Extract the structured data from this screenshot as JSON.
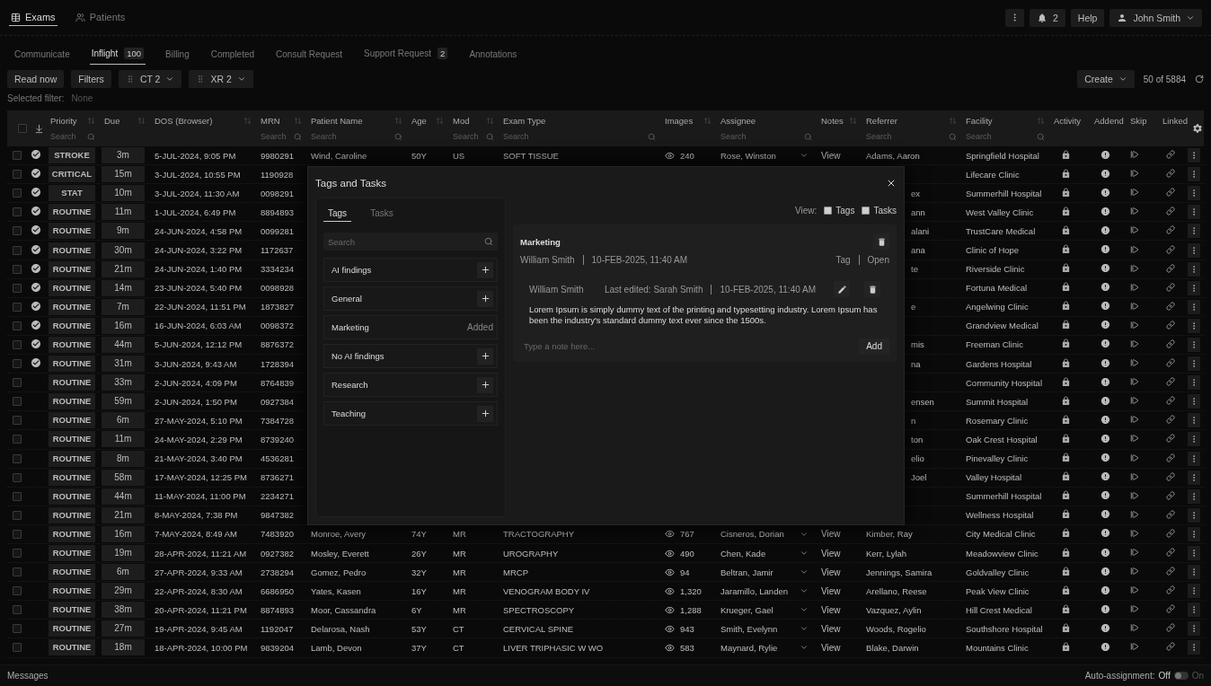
{
  "nav_tabs": [
    {
      "label": "Exams",
      "selected": true,
      "kind": "table"
    },
    {
      "label": "Patients",
      "selected": false,
      "kind": "people"
    }
  ],
  "header_actions": {
    "notifications": "2",
    "help": "Help",
    "user": "John Smith"
  },
  "sub_tabs": [
    {
      "label": "Communicate",
      "selected": false
    },
    {
      "label": "Inflight",
      "count": "100",
      "selected": true
    },
    {
      "label": "Billing",
      "selected": false
    },
    {
      "label": "Completed",
      "selected": false
    },
    {
      "label": "Consult Request",
      "selected": false
    },
    {
      "label": "Support Request",
      "count": "2",
      "selected": false
    },
    {
      "label": "Annotations",
      "selected": false
    }
  ],
  "toolbar": {
    "buttons": [
      "Read now",
      "Filters"
    ],
    "chips": [
      {
        "label": "CT",
        "count": "2"
      },
      {
        "label": "XR",
        "count": "2"
      }
    ],
    "create": "Create",
    "count": "50 of 5884"
  },
  "selected_filter": {
    "label": "Selected filter:",
    "value": "None"
  },
  "table": {
    "columns": [
      {
        "kind": "checkbox",
        "checked": false
      },
      {
        "kind": "download"
      },
      {
        "kind": "text",
        "label": "Priority",
        "sortable": true,
        "search": {
          "placeholder": "Search"
        }
      },
      {
        "kind": "text",
        "label": "Due",
        "sortable": true
      },
      {
        "kind": "text",
        "label": "DOS (Browser)",
        "sortable": true
      },
      {
        "kind": "text",
        "label": "MRN",
        "sortable": true,
        "search": {
          "placeholder": "Search"
        }
      },
      {
        "kind": "text",
        "label": "Patient Name",
        "sortable": true,
        "search": {
          "placeholder": "Search"
        }
      },
      {
        "kind": "text",
        "label": "Age",
        "sortable": true
      },
      {
        "kind": "text",
        "label": "Mod",
        "sortable": true,
        "search": {
          "placeholder": "Search"
        }
      },
      {
        "kind": "text",
        "label": "Exam Type",
        "sortable": false,
        "search": {
          "placeholder": "Search"
        }
      },
      {
        "kind": "text",
        "label": "Images",
        "sortable": true
      },
      {
        "kind": "text",
        "label": "Assignee",
        "sortable": false,
        "search": {
          "placeholder": "Search"
        }
      },
      {
        "kind": "text",
        "label": "Notes",
        "sortable": true
      },
      {
        "kind": "text",
        "label": "Referrer",
        "sortable": true,
        "search": {
          "placeholder": "Search"
        }
      },
      {
        "kind": "text",
        "label": "Facility",
        "sortable": true,
        "search": {
          "placeholder": "Search"
        }
      },
      {
        "kind": "text",
        "label": "Activity",
        "sortable": false
      },
      {
        "kind": "text",
        "label": "Addend",
        "sortable": false
      },
      {
        "kind": "text",
        "label": "Skip",
        "sortable": false
      },
      {
        "kind": "text",
        "label": "Linked",
        "sortable": false
      },
      {
        "kind": "settings"
      }
    ],
    "rows": [
      {
        "selected": false,
        "reviewed": true,
        "priority": "STROKE",
        "due": "3m",
        "dos": "5-JUL-2024, 9:05 PM",
        "mrn": "9980291",
        "patient": "Wind, Caroline",
        "age": "50Y",
        "mod": "US",
        "exam": "SOFT TISSUE",
        "images": "240",
        "assignee": "Rose, Winston",
        "notes": "View",
        "referrer": "Adams, Aaron",
        "facility": "Springfield Hospital"
      },
      {
        "selected": false,
        "reviewed": true,
        "priority": "CRITICAL",
        "due": "15m",
        "dos": "3-JUL-2024, 10:55 PM",
        "mrn": "1190928",
        "facility": "Lifecare Clinic"
      },
      {
        "selected": false,
        "reviewed": true,
        "priority": "STAT",
        "due": "10m",
        "dos": "3-JUL-2024, 11:30 AM",
        "mrn": "0098291",
        "referrer_fragment": "ex",
        "facility": "Summerhill Hospital"
      },
      {
        "selected": false,
        "reviewed": true,
        "priority": "ROUTINE",
        "due": "11m",
        "dos": "1-JUL-2024, 6:49 PM",
        "mrn": "8894893",
        "referrer_fragment": "ann",
        "facility": "West Valley Clinic"
      },
      {
        "selected": false,
        "reviewed": true,
        "priority": "ROUTINE",
        "due": "9m",
        "dos": "24-JUN-2024, 4:58 PM",
        "mrn": "0099281",
        "referrer_fragment": "alani",
        "facility": "TrustCare Medical"
      },
      {
        "selected": false,
        "reviewed": true,
        "priority": "ROUTINE",
        "due": "30m",
        "dos": "24-JUN-2024, 3:22 PM",
        "mrn": "1172637",
        "referrer_fragment": "ana",
        "facility": "Clinic of Hope"
      },
      {
        "selected": false,
        "reviewed": true,
        "priority": "ROUTINE",
        "due": "21m",
        "dos": "24-JUN-2024, 1:40 PM",
        "mrn": "3334234",
        "referrer_fragment": "te",
        "facility": "Riverside Clinic"
      },
      {
        "selected": false,
        "reviewed": true,
        "priority": "ROUTINE",
        "due": "14m",
        "dos": "23-JUN-2024, 5:40 PM",
        "mrn": "0098928",
        "facility": "Fortuna Medical"
      },
      {
        "selected": false,
        "reviewed": true,
        "priority": "ROUTINE",
        "due": "7m",
        "dos": "22-JUN-2024, 11:51 PM",
        "mrn": "1873827",
        "referrer_fragment": "e",
        "facility": "Angelwing Clinic"
      },
      {
        "selected": false,
        "reviewed": true,
        "priority": "ROUTINE",
        "due": "16m",
        "dos": "16-JUN-2024, 6:03 AM",
        "mrn": "0098372",
        "facility": "Grandview Medical"
      },
      {
        "selected": false,
        "reviewed": true,
        "priority": "ROUTINE",
        "due": "44m",
        "dos": "5-JUN-2024, 12:12 PM",
        "mrn": "8876372",
        "referrer_fragment": "mis",
        "facility": "Freeman Clinic"
      },
      {
        "selected": false,
        "reviewed": true,
        "priority": "ROUTINE",
        "due": "31m",
        "dos": "3-JUN-2024, 9:43 AM",
        "mrn": "1728394",
        "referrer_fragment": "na",
        "facility": "Gardens Hospital"
      },
      {
        "selected": false,
        "reviewed": false,
        "priority": "ROUTINE",
        "due": "33m",
        "dos": "2-JUN-2024, 4:09 PM",
        "mrn": "8764839",
        "facility": "Community Hospital"
      },
      {
        "selected": false,
        "reviewed": false,
        "priority": "ROUTINE",
        "due": "59m",
        "dos": "2-JUN-2024, 1:50 PM",
        "mrn": "0927384",
        "referrer_fragment": "ensen",
        "facility": "Summit Hospital"
      },
      {
        "selected": false,
        "reviewed": false,
        "priority": "ROUTINE",
        "due": "6m",
        "dos": "27-MAY-2024, 5:10 PM",
        "mrn": "7384728",
        "referrer_fragment": "n",
        "facility": "Rosemary Clinic"
      },
      {
        "selected": false,
        "reviewed": false,
        "priority": "ROUTINE",
        "due": "11m",
        "dos": "24-MAY-2024, 2:29 PM",
        "mrn": "8739240",
        "referrer_fragment": "ton",
        "facility": "Oak Crest Hospital"
      },
      {
        "selected": false,
        "reviewed": false,
        "priority": "ROUTINE",
        "due": "8m",
        "dos": "21-MAY-2024, 3:40 PM",
        "mrn": "4536281",
        "referrer_fragment": "elio",
        "facility": "Pinevalley Clinic"
      },
      {
        "selected": false,
        "reviewed": false,
        "priority": "ROUTINE",
        "due": "58m",
        "dos": "17-MAY-2024, 12:25 PM",
        "mrn": "8736271",
        "referrer_fragment": "Joel",
        "facility": "Valley Hospital"
      },
      {
        "selected": false,
        "reviewed": false,
        "priority": "ROUTINE",
        "due": "44m",
        "dos": "11-MAY-2024, 11:00 PM",
        "mrn": "2234271",
        "facility": "Summerhill Hospital"
      },
      {
        "selected": false,
        "reviewed": false,
        "priority": "ROUTINE",
        "due": "21m",
        "dos": "8-MAY-2024, 7:38 PM",
        "mrn": "9847382",
        "facility": "Wellness Hospital"
      },
      {
        "selected": false,
        "reviewed": false,
        "priority": "ROUTINE",
        "due": "16m",
        "dos": "7-MAY-2024, 8:49 AM",
        "mrn": "7483920",
        "patient": "Monroe, Avery",
        "age": "74Y",
        "mod": "MR",
        "exam": "TRACTOGRAPHY",
        "images": "767",
        "assignee": "Cisneros, Dorian",
        "notes": "View",
        "referrer": "Kimber, Ray",
        "facility": "City Medical Clinic"
      },
      {
        "selected": false,
        "reviewed": false,
        "priority": "ROUTINE",
        "due": "19m",
        "dos": "28-APR-2024, 11:21 AM",
        "mrn": "0927382",
        "patient": "Mosley, Everett",
        "age": "26Y",
        "mod": "MR",
        "exam": "UROGRAPHY",
        "images": "490",
        "assignee": "Chen, Kade",
        "notes": "View",
        "referrer": "Kerr, Lylah",
        "facility": "Meadowview Clinic"
      },
      {
        "selected": false,
        "reviewed": false,
        "priority": "ROUTINE",
        "due": "6m",
        "dos": "27-APR-2024, 9:33 AM",
        "mrn": "2738294",
        "patient": "Gomez, Pedro",
        "age": "32Y",
        "mod": "MR",
        "exam": "MRCP",
        "images": "94",
        "assignee": "Beltran, Jamir",
        "notes": "View",
        "referrer": "Jennings, Samira",
        "facility": "Goldvalley Clinic"
      },
      {
        "selected": false,
        "reviewed": false,
        "priority": "ROUTINE",
        "due": "29m",
        "dos": "22-APR-2024, 8:30 AM",
        "mrn": "6686950",
        "patient": "Yates, Kasen",
        "age": "16Y",
        "mod": "MR",
        "exam": "VENOGRAM BODY IV",
        "images": "1,320",
        "assignee": "Jaramillo, Landen",
        "notes": "View",
        "referrer": "Arellano, Reese",
        "facility": "Peak View Clinic"
      },
      {
        "selected": false,
        "reviewed": false,
        "priority": "ROUTINE",
        "due": "38m",
        "dos": "20-APR-2024, 11:21 PM",
        "mrn": "8874893",
        "patient": "Moor, Cassandra",
        "age": "6Y",
        "mod": "MR",
        "exam": "SPECTROSCOPY",
        "images": "1,288",
        "assignee": "Krueger, Gael",
        "notes": "View",
        "referrer": "Vazquez, Aylin",
        "facility": "Hill Crest Medical"
      },
      {
        "selected": false,
        "reviewed": false,
        "priority": "ROUTINE",
        "due": "27m",
        "dos": "19-APR-2024, 9:45 AM",
        "mrn": "1192047",
        "patient": "Delarosa, Nash",
        "age": "53Y",
        "mod": "CT",
        "exam": "CERVICAL SPINE",
        "images": "943",
        "assignee": "Smith, Evelynn",
        "notes": "View",
        "referrer": "Woods, Rogelio",
        "facility": "Southshore Hospital"
      },
      {
        "selected": false,
        "reviewed": false,
        "priority": "ROUTINE",
        "due": "18m",
        "dos": "18-APR-2024, 10:00 PM",
        "mrn": "9839204",
        "patient": "Lamb, Devon",
        "age": "37Y",
        "mod": "CT",
        "exam": "LIVER TRIPHASIC W WO",
        "images": "583",
        "assignee": "Maynard, Rylie",
        "notes": "View",
        "referrer": "Blake, Darwin",
        "facility": "Mountains Clinic"
      }
    ]
  },
  "modal": {
    "title": "Tags and Tasks",
    "tabs": [
      {
        "label": "Tags",
        "selected": true
      },
      {
        "label": "Tasks",
        "selected": false
      }
    ],
    "search": {
      "placeholder": "Search"
    },
    "tags": [
      {
        "label": "AI findings",
        "added": false
      },
      {
        "label": "General",
        "added": false
      },
      {
        "label": "Marketing",
        "added": true,
        "added_label": "Added"
      },
      {
        "label": "No AI findings",
        "added": false
      },
      {
        "label": "Research",
        "added": false
      },
      {
        "label": "Teaching",
        "added": false
      }
    ],
    "view": {
      "label": "View:",
      "options": [
        {
          "label": "Tags",
          "checked": true
        },
        {
          "label": "Tasks",
          "checked": true
        }
      ]
    },
    "card": {
      "title": "Marketing",
      "author": "William Smith",
      "date": "10-FEB-2025, 11:40 AM",
      "type": "Tag",
      "status": "Open",
      "notes": [
        {
          "author": "William Smith",
          "edited": "Last edited: Sarah Smith",
          "date": "10-FEB-2025, 11:40 AM",
          "text": "Lorem Ipsum is simply dummy text of the printing and typesetting industry. Lorem Ipsum has been the industry's standard dummy text ever since the 1500s."
        }
      ],
      "note_input": {
        "placeholder": "Type a note here..."
      },
      "add_button": "Add"
    }
  },
  "status_bar": {
    "messages": "Messages",
    "auto_label": "Auto-assignment:",
    "off": "Off",
    "on_label": "On",
    "on": false
  }
}
